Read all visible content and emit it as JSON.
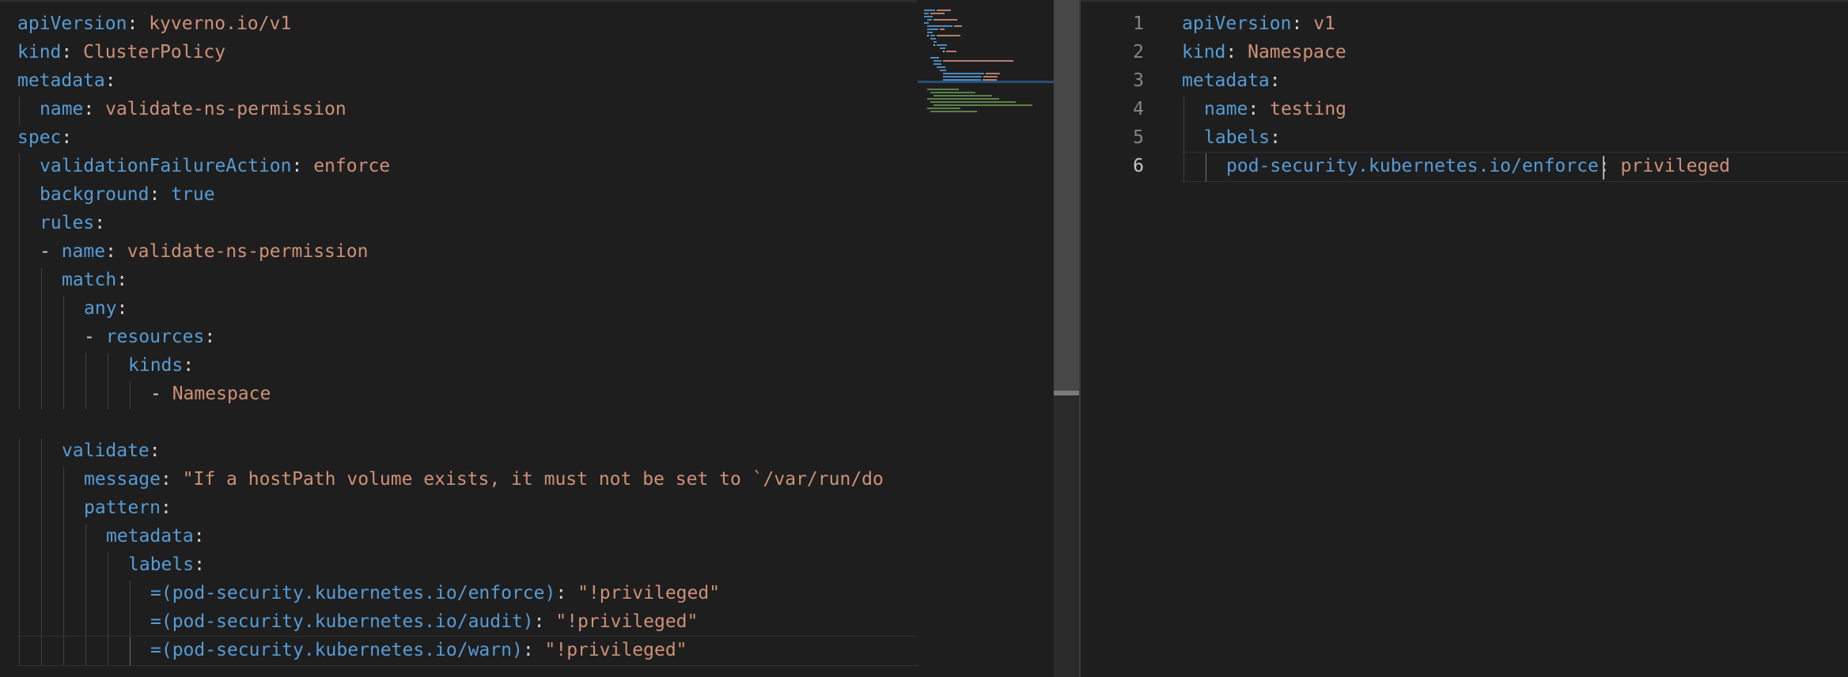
{
  "left_editor": {
    "lines": [
      {
        "indent": 0,
        "key": "apiVersion",
        "sep": ": ",
        "value": "kyverno.io/v1"
      },
      {
        "indent": 0,
        "key": "kind",
        "sep": ": ",
        "value": "ClusterPolicy"
      },
      {
        "indent": 0,
        "key": "metadata",
        "sep": ":",
        "value": ""
      },
      {
        "indent": 1,
        "key": "name",
        "sep": ": ",
        "value": "validate-ns-permission"
      },
      {
        "indent": 0,
        "key": "spec",
        "sep": ":",
        "value": ""
      },
      {
        "indent": 1,
        "key": "validationFailureAction",
        "sep": ": ",
        "value": "enforce"
      },
      {
        "indent": 1,
        "key": "background",
        "sep": ": ",
        "value": "true",
        "value_is_keyword": true
      },
      {
        "indent": 1,
        "key": "rules",
        "sep": ":",
        "value": ""
      },
      {
        "indent": 1,
        "dash": true,
        "key": "name",
        "sep": ": ",
        "value": "validate-ns-permission"
      },
      {
        "indent": 2,
        "key": "match",
        "sep": ":",
        "value": ""
      },
      {
        "indent": 3,
        "key": "any",
        "sep": ":",
        "value": ""
      },
      {
        "indent": 3,
        "dash": true,
        "key": "resources",
        "sep": ":",
        "value": ""
      },
      {
        "indent": 5,
        "key": "kinds",
        "sep": ":",
        "value": ""
      },
      {
        "indent": 6,
        "dash": true,
        "key": "",
        "sep": "",
        "value": "Namespace"
      },
      {
        "indent": 0,
        "key": "",
        "sep": "",
        "value": ""
      },
      {
        "indent": 2,
        "key": "validate",
        "sep": ":",
        "value": ""
      },
      {
        "indent": 3,
        "key": "message",
        "sep": ": ",
        "value": "\"If a hostPath volume exists, it must not be set to `/var/run/do"
      },
      {
        "indent": 3,
        "key": "pattern",
        "sep": ":",
        "value": ""
      },
      {
        "indent": 4,
        "key": "metadata",
        "sep": ":",
        "value": ""
      },
      {
        "indent": 5,
        "key": "labels",
        "sep": ":",
        "value": ""
      },
      {
        "indent": 6,
        "key": "=(pod-security.kubernetes.io/enforce)",
        "sep": ": ",
        "value": "\"!privileged\""
      },
      {
        "indent": 6,
        "key": "=(pod-security.kubernetes.io/audit)",
        "sep": ": ",
        "value": "\"!privileged\""
      },
      {
        "indent": 6,
        "key": "=(pod-security.kubernetes.io/warn)",
        "sep": ": ",
        "value": "\"!privileged\"",
        "current": true
      }
    ]
  },
  "right_editor": {
    "lines": [
      {
        "number": "1",
        "indent": 0,
        "key": "apiVersion",
        "sep": ": ",
        "value": "v1"
      },
      {
        "number": "2",
        "indent": 0,
        "key": "kind",
        "sep": ": ",
        "value": "Namespace"
      },
      {
        "number": "3",
        "indent": 0,
        "key": "metadata",
        "sep": ":",
        "value": ""
      },
      {
        "number": "4",
        "indent": 1,
        "key": "name",
        "sep": ": ",
        "value": "testing"
      },
      {
        "number": "5",
        "indent": 1,
        "key": "labels",
        "sep": ":",
        "value": ""
      },
      {
        "number": "6",
        "indent": 2,
        "key": "pod-security.kubernetes.io/enforce",
        "sep": ": ",
        "value": "privileged",
        "current": true
      }
    ]
  },
  "colors": {
    "background": "#1e1e1e",
    "key": "#569cd6",
    "value": "#ce9178",
    "punctuation": "#d4d4d4",
    "line_number": "#858585"
  }
}
